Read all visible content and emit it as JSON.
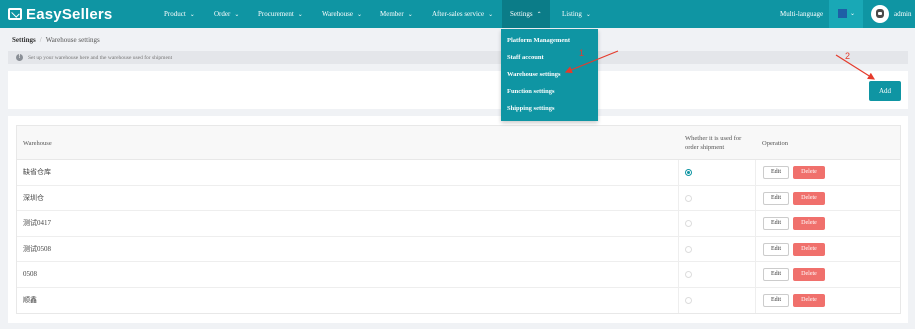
{
  "app": {
    "logo_text": "EasySellers"
  },
  "nav": [
    {
      "label": "Product",
      "chev": "⌄"
    },
    {
      "label": "Order",
      "chev": "⌄"
    },
    {
      "label": "Procurement",
      "chev": "⌄"
    },
    {
      "label": "Warehouse",
      "chev": "⌄"
    },
    {
      "label": "Member",
      "chev": "⌄"
    },
    {
      "label": "After-sales service",
      "chev": "⌄"
    },
    {
      "label": "Settings",
      "chev": "⌃"
    },
    {
      "label": "Listing",
      "chev": "⌄"
    }
  ],
  "header_right": {
    "language": "Multi-language",
    "flag_chev": "⌄",
    "user": "admin"
  },
  "breadcrumb": {
    "root": "Settings",
    "sep": "/",
    "current": "Warehouse settings"
  },
  "tip": {
    "icon": "!",
    "text": "Set up your warehouse here and the warehouse used for shipment"
  },
  "toolbar": {
    "add_label": "Add"
  },
  "table": {
    "headers": {
      "warehouse": "Warehouse",
      "shipment_line1": "Whether it is used for",
      "shipment_line2": "order shipment",
      "operation": "Operation"
    },
    "rows": [
      {
        "name": "缺省仓库",
        "selected": true
      },
      {
        "name": "深圳仓",
        "selected": false
      },
      {
        "name": "测试0417",
        "selected": false
      },
      {
        "name": "测试0508",
        "selected": false
      },
      {
        "name": "0508",
        "selected": false
      },
      {
        "name": "顺鑫",
        "selected": false
      }
    ],
    "edit_label": "Edit",
    "delete_label": "Delete"
  },
  "dropdown": {
    "items": [
      "Platform Management",
      "Staff account",
      "Warehouse settings",
      "Function settings",
      "Shipping settings"
    ]
  },
  "annotations": {
    "one": "1",
    "two": "2"
  },
  "colors": {
    "primary": "#0f95a3",
    "danger": "#f0706c",
    "annotation": "#e53b2c"
  }
}
